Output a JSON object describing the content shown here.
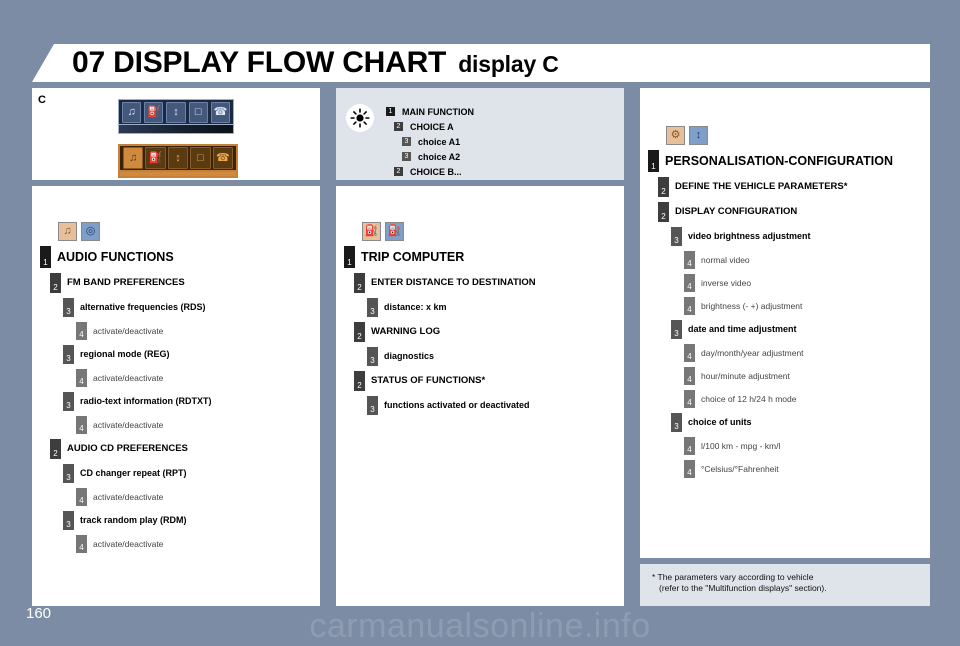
{
  "page": {
    "number": "160",
    "watermark": "carmanualsonline.info",
    "bg_color": "#7c8ca5"
  },
  "header": {
    "chapter": "07 DISPLAY FLOW CHART",
    "subtitle": "display C"
  },
  "display_preview": {
    "variant_label": "C",
    "inverse_video": {
      "name": "display-inverse-video",
      "cells": [
        "♫",
        "⛽",
        "↕",
        "□",
        "☎"
      ]
    },
    "normal_video": {
      "name": "display-normal-video",
      "cells": [
        "♫",
        "⛽",
        "↕",
        "□",
        "☎"
      ]
    }
  },
  "legend": {
    "icon": "sun-brightness-icon",
    "rows": [
      {
        "level": 1,
        "label": "MAIN FUNCTION"
      },
      {
        "level": 2,
        "label": "CHOICE A"
      },
      {
        "level": 3,
        "label": "choice A1"
      },
      {
        "level": 3,
        "label": "choice A2"
      },
      {
        "level": 2,
        "label": "CHOICE B..."
      }
    ]
  },
  "columns": [
    {
      "name": "audio-functions",
      "icons": [
        "radio-music-icon",
        "cd-disc-icon"
      ],
      "rows": [
        {
          "level": 1,
          "label": "AUDIO FUNCTIONS"
        },
        {
          "level": 2,
          "label": "FM BAND PREFERENCES"
        },
        {
          "level": 3,
          "label": "alternative frequencies (RDS)"
        },
        {
          "level": 4,
          "label": "activate/deactivate"
        },
        {
          "level": 3,
          "label": "regional mode (REG)"
        },
        {
          "level": 4,
          "label": "activate/deactivate"
        },
        {
          "level": 3,
          "label": "radio-text information (RDTXT)"
        },
        {
          "level": 4,
          "label": "activate/deactivate"
        },
        {
          "level": 2,
          "label": "AUDIO CD PREFERENCES"
        },
        {
          "level": 3,
          "label": "CD changer repeat (RPT)"
        },
        {
          "level": 4,
          "label": "activate/deactivate"
        },
        {
          "level": 3,
          "label": "track random play (RDM)"
        },
        {
          "level": 4,
          "label": "activate/deactivate"
        }
      ]
    },
    {
      "name": "trip-computer",
      "icons": [
        "fuel-pump-icon",
        "fuel-pump-icon"
      ],
      "rows": [
        {
          "level": 1,
          "label": "TRIP COMPUTER"
        },
        {
          "level": 2,
          "label": "ENTER DISTANCE TO DESTINATION"
        },
        {
          "level": 3,
          "label": "distance: x km"
        },
        {
          "level": 2,
          "label": "WARNING LOG"
        },
        {
          "level": 3,
          "label": "diagnostics"
        },
        {
          "level": 2,
          "label": "STATUS OF FUNCTIONS*"
        },
        {
          "level": 3,
          "label": "functions activated or deactivated"
        }
      ]
    },
    {
      "name": "personalisation-configuration",
      "icons": [
        "settings-panel-icon",
        "sliders-icon"
      ],
      "rows": [
        {
          "level": 1,
          "label": "PERSONALISATION-CONFIGURATION"
        },
        {
          "level": 2,
          "label": "DEFINE THE VEHICLE PARAMETERS*"
        },
        {
          "level": 2,
          "label": "DISPLAY CONFIGURATION"
        },
        {
          "level": 3,
          "label": "video brightness adjustment"
        },
        {
          "level": 4,
          "label": "normal video"
        },
        {
          "level": 4,
          "label": "inverse video"
        },
        {
          "level": 4,
          "label": "brightness (- +) adjustment"
        },
        {
          "level": 3,
          "label": "date and time adjustment"
        },
        {
          "level": 4,
          "label": "day/month/year adjustment"
        },
        {
          "level": 4,
          "label": "hour/minute adjustment"
        },
        {
          "level": 4,
          "label": "choice of 12 h/24 h mode"
        },
        {
          "level": 3,
          "label": "choice of units"
        },
        {
          "level": 4,
          "label": "l/100 km - mpg - km/l"
        },
        {
          "level": 4,
          "label": "°Celsius/°Fahrenheit"
        }
      ]
    }
  ],
  "footnote": {
    "line1": "* The parameters vary according to vehicle",
    "line2": "(refer to the \"Multifunction displays\" section)."
  }
}
